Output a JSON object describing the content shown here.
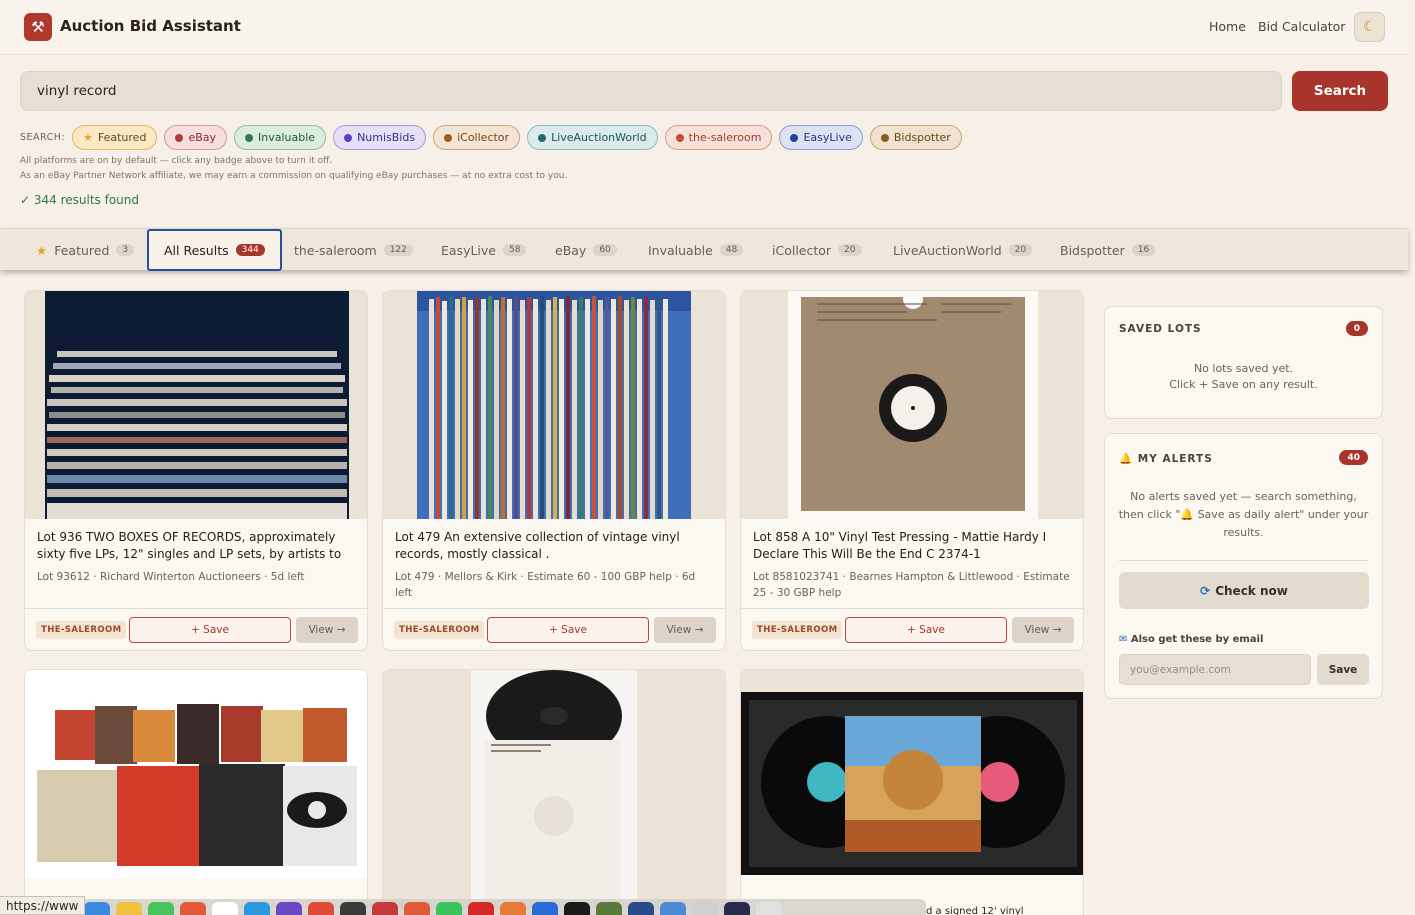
{
  "header": {
    "title": "Auction Bid Assistant",
    "logo_icon": "gavel-icon",
    "nav": {
      "home": "Home",
      "bid_calculator": "Bid Calculator"
    },
    "theme_icon": "moon-icon"
  },
  "search": {
    "value": "vinyl record",
    "button": "Search",
    "label": "SEARCH:",
    "badges": [
      {
        "label": "Featured",
        "icon": "star-icon",
        "color": "#e0a82e"
      },
      {
        "label": "eBay",
        "color": "#b23a3a"
      },
      {
        "label": "Invaluable",
        "color": "#2e7d4a"
      },
      {
        "label": "NumisBids",
        "color": "#5b3fc4"
      },
      {
        "label": "iCollector",
        "color": "#a05a1e"
      },
      {
        "label": "LiveAuctionWorld",
        "color": "#1e6b73"
      },
      {
        "label": "the-saleroom",
        "color": "#c2503a"
      },
      {
        "label": "EasyLive",
        "color": "#2a3f9a"
      },
      {
        "label": "Bidspotter",
        "color": "#8a5a1e"
      }
    ],
    "note_platforms": "All platforms are on by default — click any badge above to turn it off.",
    "note_affiliate": "As an eBay Partner Network affiliate, we may earn a commission on qualifying eBay purchases — at no extra cost to you.",
    "results_found": "✓ 344 results found"
  },
  "tabs": [
    {
      "label": "Featured",
      "count": "3",
      "icon": "star-icon"
    },
    {
      "label": "All Results",
      "count": "344",
      "active": true
    },
    {
      "label": "the-saleroom",
      "count": "122"
    },
    {
      "label": "EasyLive",
      "count": "58"
    },
    {
      "label": "eBay",
      "count": "60"
    },
    {
      "label": "Invaluable",
      "count": "48"
    },
    {
      "label": "iCollector",
      "count": "20"
    },
    {
      "label": "LiveAuctionWorld",
      "count": "20"
    },
    {
      "label": "Bidspotter",
      "count": "16"
    }
  ],
  "results": [
    {
      "title": "Lot 936 TWO BOXES OF RECORDS, approximately sixty five LPs, 12\" singles and LP sets, by artists to",
      "meta": "Lot 93612 · Richard Winterton Auctioneers · 5d left",
      "source": "THE-SALEROOM",
      "save": "+ Save",
      "view": "View →"
    },
    {
      "title": "Lot 479 An extensive collection of vintage vinyl records, mostly classical .",
      "meta": "Lot 479 · Mellors & Kirk · Estimate 60 - 100 GBP help · 6d left",
      "source": "THE-SALEROOM",
      "save": "+ Save",
      "view": "View →"
    },
    {
      "title": "Lot 858 A 10\" Vinyl Test Pressing - Mattie Hardy I Declare This Will Be the End C 2374-1",
      "meta": "Lot 8581023741 · Bearnes Hampton & Littlewood · Estimate 25 - 30 GBP help",
      "source": "THE-SALEROOM",
      "save": "+ Save",
      "view": "View →"
    }
  ],
  "second_row_partial_text": "d a signed 12' vinyl",
  "saved_lots": {
    "title": "SAVED LOTS",
    "count": "0",
    "empty_line1": "No lots saved yet.",
    "empty_line2": "Click + Save on any result."
  },
  "alerts": {
    "title": "MY ALERTS",
    "icon": "bell-icon",
    "count": "40",
    "empty_line1": "No alerts saved yet — search something,",
    "empty_line2": "then click \"🔔 Save as daily alert\" under your",
    "empty_line3": "results.",
    "check_now": "Check now",
    "email_label": "Also get these by email",
    "email_placeholder": "you@example.com",
    "email_save": "Save"
  },
  "status_url": "https://www"
}
